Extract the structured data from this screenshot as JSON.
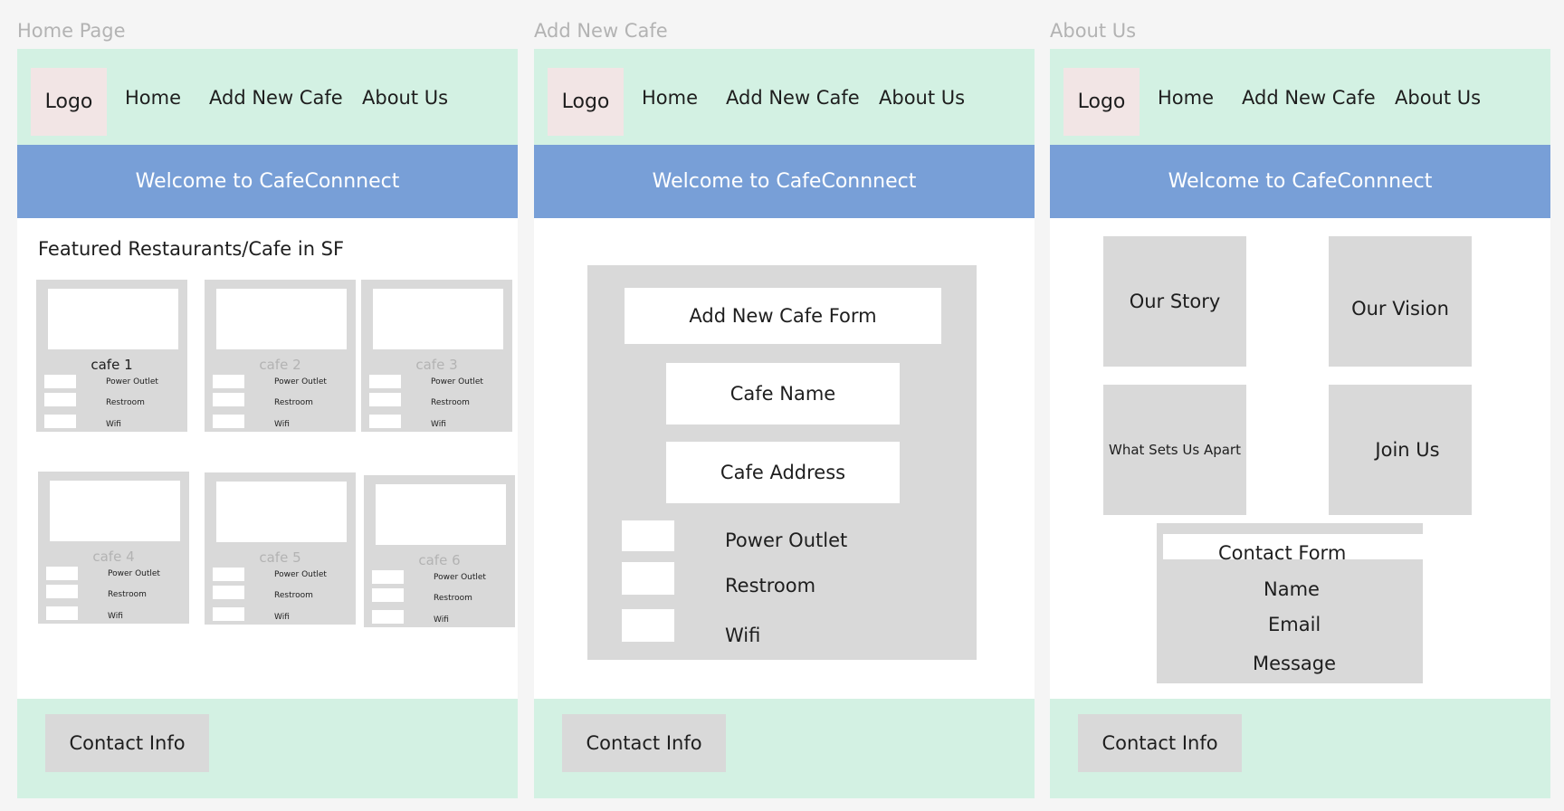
{
  "frames": [
    {
      "label": "Home Page",
      "logo": "Logo",
      "nav": [
        "Home",
        "Add New Cafe",
        "About Us"
      ],
      "banner": "Welcome to CafeConnnect",
      "section_title": "Featured Restaurants/Cafe in SF",
      "cafes": [
        {
          "name": "cafe 1"
        },
        {
          "name": "cafe 2"
        },
        {
          "name": "cafe 3"
        },
        {
          "name": "cafe 4"
        },
        {
          "name": "cafe 5"
        },
        {
          "name": "cafe 6"
        }
      ],
      "amenities": [
        "Power Outlet",
        "Restroom",
        "Wifi"
      ],
      "footer": "Contact Info"
    },
    {
      "label": "Add New Cafe",
      "logo": "Logo",
      "nav": [
        "Home",
        "Add New Cafe",
        "About Us"
      ],
      "banner": "Welcome to CafeConnnect",
      "form": {
        "title": "Add New Cafe Form",
        "name_field": "Cafe Name",
        "address_field": "Cafe Address",
        "checkboxes": [
          "Power Outlet",
          "Restroom",
          "Wifi"
        ]
      },
      "footer": "Contact Info"
    },
    {
      "label": "About Us",
      "logo": "Logo",
      "nav": [
        "Home",
        "Add New Cafe",
        "About Us"
      ],
      "banner": "Welcome to CafeConnnect",
      "tiles": [
        "Our Story",
        "Our Vision",
        "What Sets Us Apart",
        "Join Us"
      ],
      "contact_form": {
        "title": "Contact Form",
        "fields": [
          "Name",
          "Email",
          "Message"
        ]
      },
      "footer": "Contact Info"
    }
  ],
  "colors": {
    "nav_bg": "#d3f1e3",
    "banner_bg": "#789fd7",
    "logo_bg": "#f2e5e5",
    "placeholder_gray": "#d9d9d9",
    "canvas_bg": "#f5f5f5"
  }
}
